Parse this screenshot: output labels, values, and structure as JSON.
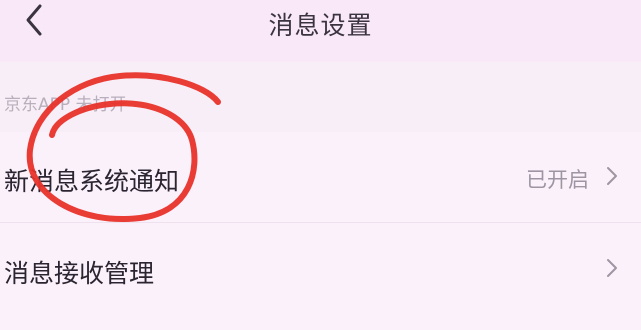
{
  "header": {
    "title": "消息设置",
    "back_icon": "chevron-left-icon"
  },
  "section": {
    "label": "京东APP 未打开"
  },
  "settings": [
    {
      "label": "新消息系统通知",
      "status": "已开启",
      "icon": "chevron-right-icon"
    },
    {
      "label": "消息接收管理",
      "status": "",
      "icon": "chevron-right-icon"
    }
  ],
  "annotation": {
    "shape": "hand-drawn circle",
    "color": "#e8322a"
  },
  "colors": {
    "background": "#f7eef7",
    "header_background": "#f9e8f8",
    "text_primary": "#2a2530",
    "text_secondary": "#9e95a3"
  }
}
